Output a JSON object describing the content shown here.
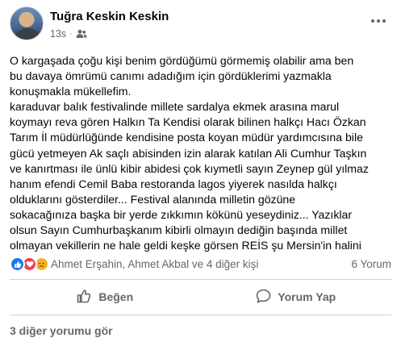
{
  "post": {
    "author": "Tuğra Keskin Keskin",
    "time": "13s",
    "separator": "·",
    "audience_icon": "friends-icon",
    "more_icon": "more-options-icon",
    "text_lines": [
      "O kargaşada çoğu kişi benim gördüğümü görmemiş olabilir ama ben",
      "bu davaya ömrümü canımı adadığım için gördüklerimi yazmakla",
      "konuşmakla mükellefim.",
      "karaduvar balık festivalinde millete sardalya ekmek arasına marul",
      "koymayı reva gören Halkın Ta Kendisi olarak bilinen halkçı Hacı Özkan",
      "Tarım İl müdürlüğünde kendisine posta koyan müdür yardımcısına bile",
      "gücü yetmeyen Ak saçlı abisinden izin alarak katılan Ali Cumhur Taşkın",
      "ve kanırtması ile ünlü kibir abidesi çok kıymetli sayın Zeynep gül yılmaz",
      "hanım efendi Cemil Baba restoranda lagos yiyerek nasılda halkçı",
      "olduklarını gösterdiler... Festival alanında milletin gözüne",
      "sokacağınıza başka bir yerde zıkkımın kökünü yeseydiniz... Yazıklar",
      "olsun Sayın Cumhurbaşkanım kibirli olmayın dediğin başında millet",
      "olmayan vekillerin ne hale geldi keşke görsen REİS  şu Mersin'in halini"
    ]
  },
  "reactions": {
    "icons": [
      "like-reaction-icon",
      "love-reaction-icon",
      "sad-reaction-icon"
    ],
    "names": "Ahmet Erşahin, Ahmet Akbal ve 4 diğer kişi",
    "comment_count": "6 Yorum"
  },
  "actions": {
    "like_label": "Beğen",
    "comment_label": "Yorum Yap"
  },
  "comments": {
    "more_label": "3 diğer yorumu gör"
  },
  "colors": {
    "like": "#1877f2",
    "love": "#f33e58",
    "sad": "#f7b125",
    "secondary_text": "#65676b"
  }
}
